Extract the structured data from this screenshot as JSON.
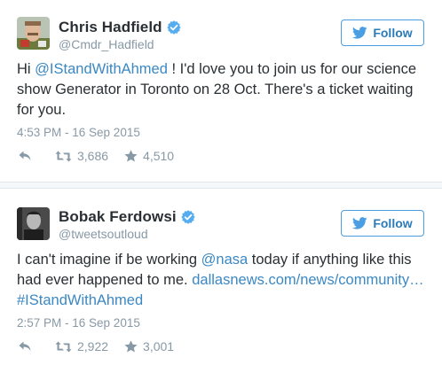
{
  "tweets": [
    {
      "name": "Chris Hadfield",
      "handle": "@Cmdr_Hadfield",
      "follow_label": "Follow",
      "text_parts": {
        "p1": "Hi ",
        "mention": "@IStandWithAhmed",
        "p2": " ! I'd love you to join us for our science show Generator in Toronto on 28 Oct. There's a ticket waiting for you."
      },
      "timestamp": "4:53 PM - 16 Sep 2015",
      "retweets": "3,686",
      "likes": "4,510",
      "icons": [
        "reply-icon",
        "retweet-icon",
        "star-icon",
        "verified-icon",
        "twitter-bird-icon"
      ]
    },
    {
      "name": "Bobak Ferdowsi",
      "handle": "@tweetsoutloud",
      "follow_label": "Follow",
      "text_parts": {
        "p1": "I can't imagine if be working ",
        "mention": "@nasa",
        "p2": " today if anything like this had ever happened to me. ",
        "url": "dallasnews.com/news/community…",
        "p3": " ",
        "hashtag": "#IStandWithAhmed"
      },
      "timestamp": "2:57 PM - 16 Sep 2015",
      "retweets": "2,922",
      "likes": "3,001",
      "icons": [
        "reply-icon",
        "retweet-icon",
        "star-icon",
        "verified-icon",
        "twitter-bird-icon"
      ]
    }
  ],
  "colors": {
    "link": "#3b88c3",
    "verified": "#55acee",
    "meta": "#8899a6",
    "text": "#292f33",
    "follow_border": "#4a9ee3"
  }
}
